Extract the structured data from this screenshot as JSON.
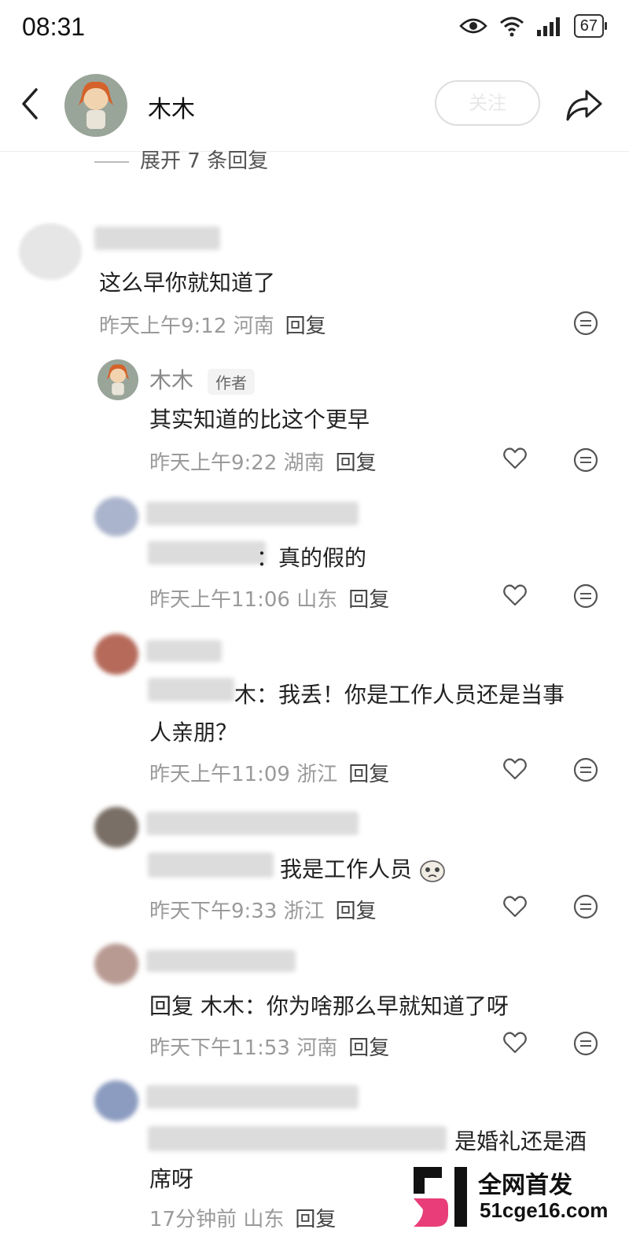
{
  "status_bar": {
    "time": "08:31",
    "battery": "67"
  },
  "header": {
    "name": "木木",
    "follow_label": "关注"
  },
  "collapsed_replies": "展开 7 条回复",
  "comments": [
    {
      "text": "这么早你就知道了",
      "time": "昨天上午9:12",
      "location": "河南",
      "reply": "回复"
    },
    {
      "name": "木木",
      "tag": "作者",
      "text": "其实知道的比这个更早",
      "time": "昨天上午9:22",
      "location": "湖南",
      "reply": "回复"
    },
    {
      "text": "：真的假的",
      "time": "昨天上午11:06",
      "location": "山东",
      "reply": "回复"
    },
    {
      "text_line1": "木：我丢！你是工作人员还是当事",
      "text_line2": "人亲朋？",
      "time": "昨天上午11:09",
      "location": "浙江",
      "reply": "回复"
    },
    {
      "text": "我是工作人员",
      "time": "昨天下午9:33",
      "location": "浙江",
      "reply": "回复"
    },
    {
      "text": "回复  木木：你为啥那么早就知道了呀",
      "time": "昨天下午11:53",
      "location": "河南",
      "reply": "回复"
    },
    {
      "text_line1": "是婚礼还是酒",
      "text_line2": "席呀",
      "time": "17分钟前",
      "location": "山东",
      "reply": "回复"
    }
  ],
  "watermark": {
    "line1": "全网首发",
    "line2": "51cge16.com"
  },
  "icons": [
    "back-arrow-icon",
    "share-icon",
    "heart-icon",
    "emoji-icon",
    "eye-icon",
    "wifi-icon",
    "signal-icon"
  ]
}
